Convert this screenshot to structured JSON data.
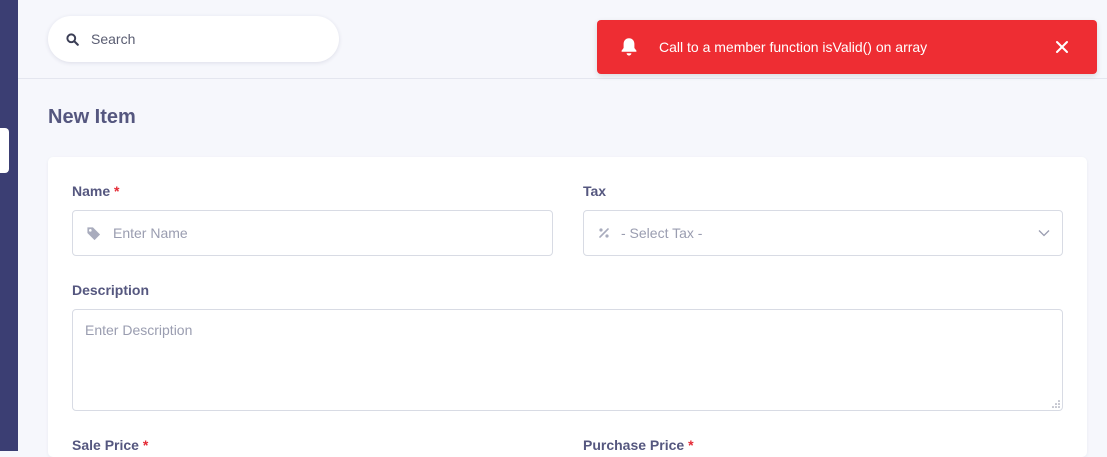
{
  "search": {
    "placeholder": "Search"
  },
  "notification": {
    "message": "Call to a member function isValid() on array",
    "color": "#ee2d33"
  },
  "page": {
    "title": "New Item"
  },
  "form": {
    "name": {
      "label": "Name",
      "required_mark": "*",
      "placeholder": "Enter Name",
      "icon": "tag-icon"
    },
    "tax": {
      "label": "Tax",
      "selected": "- Select Tax -",
      "icon": "percent-icon"
    },
    "description": {
      "label": "Description",
      "placeholder": "Enter Description"
    },
    "sale_price": {
      "label": "Sale Price",
      "required_mark": "*"
    },
    "purchase_price": {
      "label": "Purchase Price",
      "required_mark": "*"
    }
  },
  "theme": {
    "sidebar": "#3b3e73",
    "accent_text": "#55577f",
    "required": "#e42a35"
  }
}
